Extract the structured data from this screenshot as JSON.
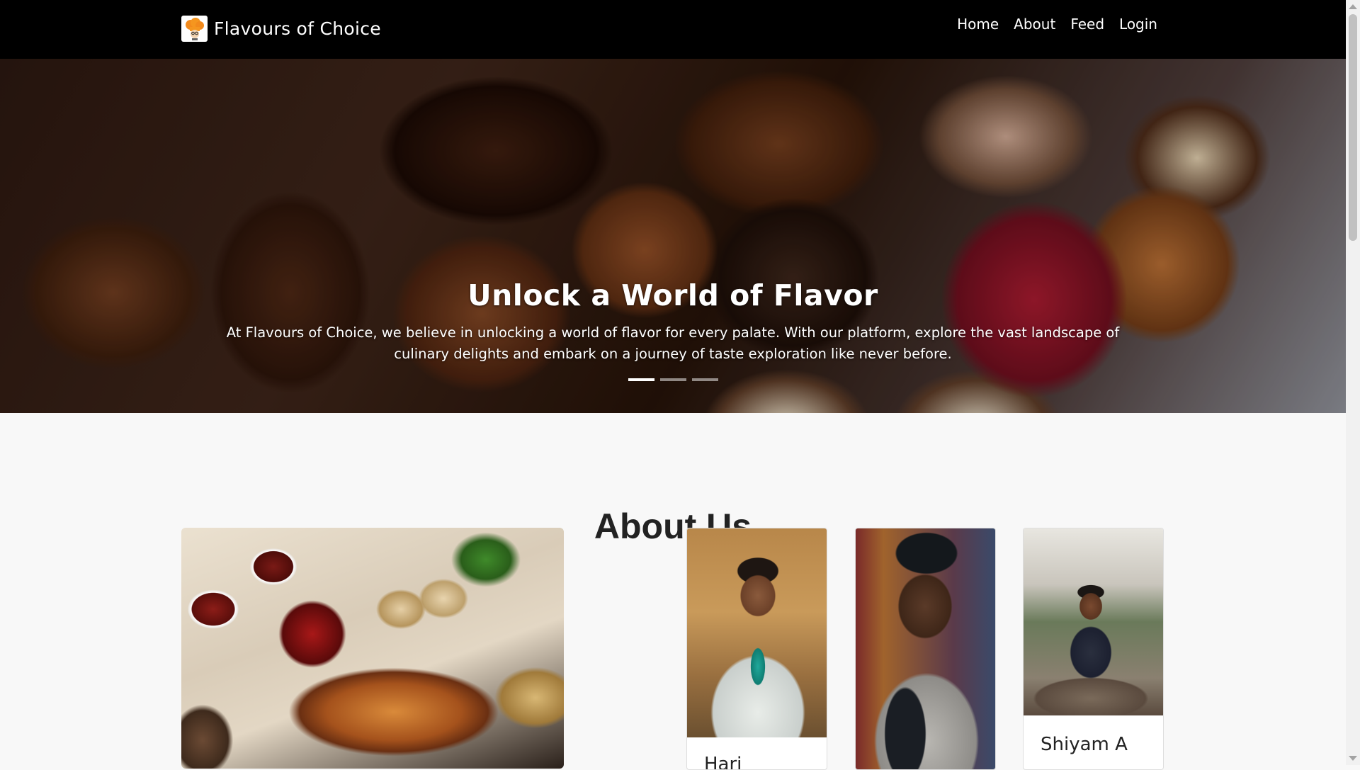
{
  "navbar": {
    "brand": "Flavours of Choice",
    "links": [
      "Home",
      "About",
      "Feed",
      "Login"
    ]
  },
  "hero": {
    "title": "Unlock a World of Flavor",
    "text": "At Flavours of Choice, we believe in unlocking a world of flavor for every palate. With our platform, explore the vast landscape of culinary delights and embark on a journey of taste exploration like never before.",
    "slides_total": 3,
    "active_slide": 1
  },
  "about": {
    "heading": "About Us",
    "team": [
      {
        "name": "Hari"
      },
      {
        "name": ""
      },
      {
        "name": "Shiyam A"
      }
    ]
  }
}
